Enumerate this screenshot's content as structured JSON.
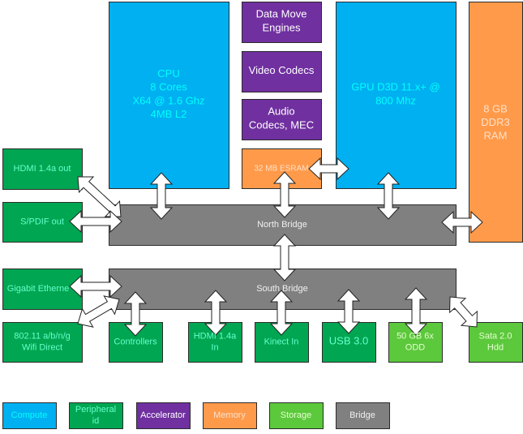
{
  "colors": {
    "compute": "#00b0f0",
    "compute_text": "#00ffff",
    "peripheral": "#00a651",
    "peripheral_text": "#66ffcc",
    "accelerator": "#7030a0",
    "accelerator_text": "#ffffff",
    "memory": "#ff9a4a",
    "memory_text": "#fde0c8",
    "storage": "#5cc83c",
    "storage_text": "#e4ffd0",
    "bridge": "#808080",
    "bridge_text": "#f0f0f0"
  },
  "blocks": {
    "cpu": {
      "lines": [
        "CPU",
        "8 Cores",
        "X64 @ 1.6 Ghz",
        "4MB L2"
      ],
      "category": "compute"
    },
    "gpu": {
      "lines": [
        "GPU D3D 11.x+ @",
        "800 Mhz"
      ],
      "category": "compute"
    },
    "data_move": {
      "lines": [
        "Data Move",
        "Engines"
      ],
      "category": "accelerator"
    },
    "video_codecs": {
      "lines": [
        "Video Codecs"
      ],
      "category": "accelerator"
    },
    "audio_codecs": {
      "lines": [
        "Audio",
        "Codecs, MEC"
      ],
      "category": "accelerator"
    },
    "esram": {
      "lines": [
        "32 MB ESRAM"
      ],
      "category": "memory"
    },
    "ram": {
      "lines": [
        "8 GB",
        "DDR3",
        "RAM"
      ],
      "category": "memory"
    },
    "north_bridge": {
      "lines": [
        "North Bridge"
      ],
      "category": "bridge"
    },
    "south_bridge": {
      "lines": [
        "South Bridge"
      ],
      "category": "bridge"
    },
    "hdmi_out": {
      "lines": [
        "HDMI 1.4a out"
      ],
      "category": "peripheral"
    },
    "spdif_out": {
      "lines": [
        "S/PDIF out"
      ],
      "category": "peripheral"
    },
    "gigabit_ethernet": {
      "lines": [
        "Gigabit Etherne"
      ],
      "category": "peripheral"
    },
    "wifi": {
      "lines": [
        "802.11 a/b/n/g",
        "Wifi Direct"
      ],
      "category": "peripheral"
    },
    "controllers": {
      "lines": [
        "Controllers"
      ],
      "category": "peripheral"
    },
    "hdmi_in": {
      "lines": [
        "HDMI 1.4a",
        "In"
      ],
      "category": "peripheral"
    },
    "kinect_in": {
      "lines": [
        "Kinect In"
      ],
      "category": "peripheral"
    },
    "usb": {
      "lines": [
        "USB 3.0"
      ],
      "category": "peripheral"
    },
    "odd": {
      "lines": [
        "50 GB 6x",
        "ODD"
      ],
      "category": "storage"
    },
    "hdd": {
      "lines": [
        "Sata 2.0",
        "Hdd"
      ],
      "category": "storage"
    }
  },
  "connections": [
    [
      "cpu",
      "north_bridge"
    ],
    [
      "gpu",
      "north_bridge"
    ],
    [
      "esram",
      "gpu"
    ],
    [
      "esram",
      "north_bridge"
    ],
    [
      "north_bridge",
      "ram"
    ],
    [
      "north_bridge",
      "south_bridge"
    ],
    [
      "hdmi_out",
      "north_bridge"
    ],
    [
      "spdif_out",
      "north_bridge"
    ],
    [
      "gigabit_ethernet",
      "south_bridge"
    ],
    [
      "wifi",
      "south_bridge"
    ],
    [
      "controllers",
      "south_bridge"
    ],
    [
      "hdmi_in",
      "south_bridge"
    ],
    [
      "kinect_in",
      "south_bridge"
    ],
    [
      "usb",
      "south_bridge"
    ],
    [
      "odd",
      "south_bridge"
    ],
    [
      "hdd",
      "south_bridge"
    ]
  ],
  "legend": [
    {
      "lines": [
        "Compute"
      ],
      "category": "compute"
    },
    {
      "lines": [
        "Peripheral",
        "id"
      ],
      "category": "peripheral"
    },
    {
      "lines": [
        "Accelerator"
      ],
      "category": "accelerator"
    },
    {
      "lines": [
        "Memory"
      ],
      "category": "memory"
    },
    {
      "lines": [
        "Storage"
      ],
      "category": "storage"
    },
    {
      "lines": [
        "Bridge"
      ],
      "category": "bridge"
    }
  ]
}
